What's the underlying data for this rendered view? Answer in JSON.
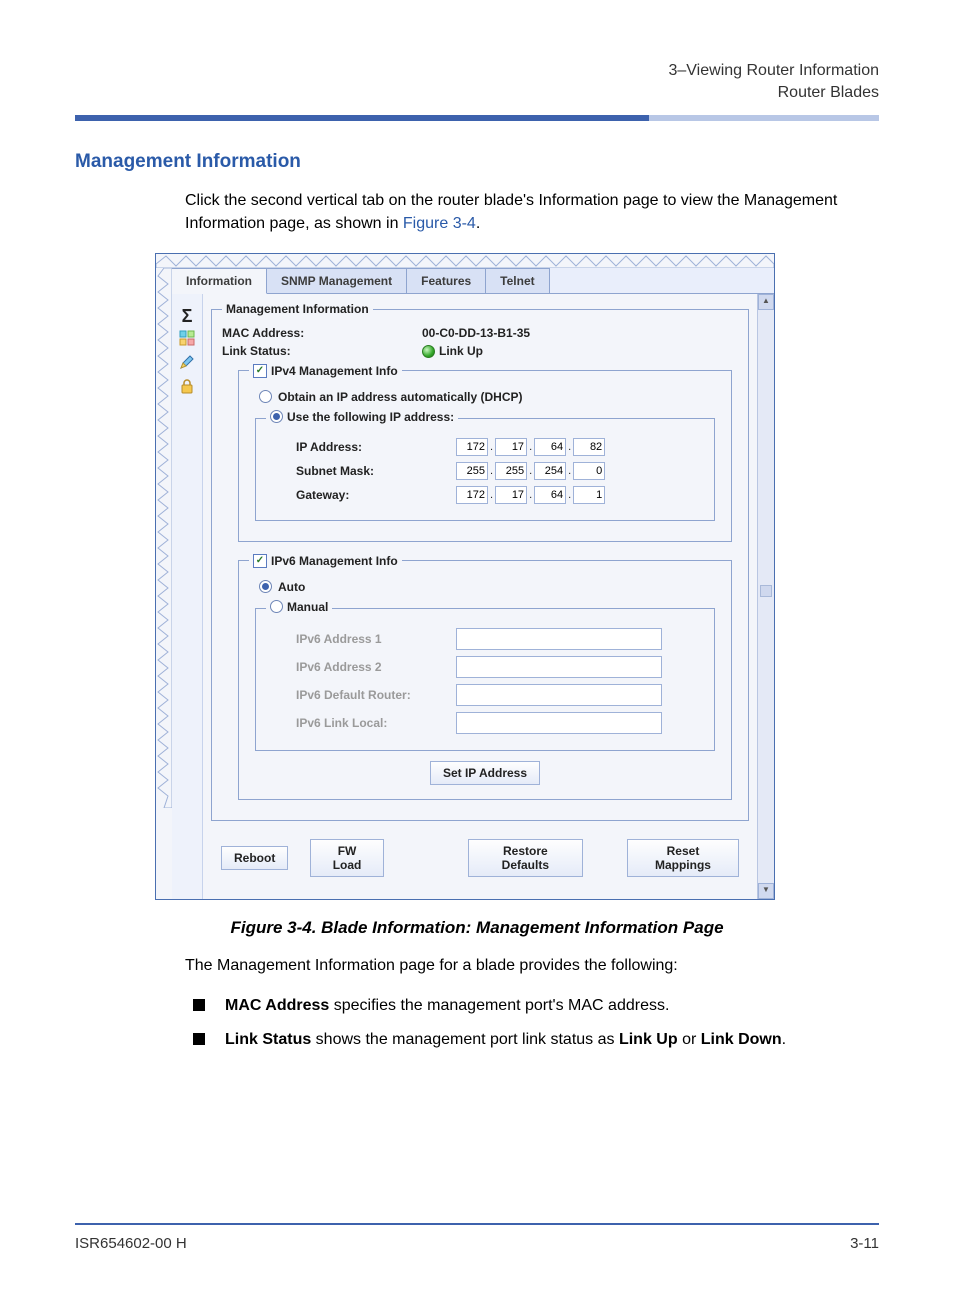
{
  "header": {
    "line1": "3–Viewing Router Information",
    "line2": "Router Blades"
  },
  "section_title": "Management Information",
  "intro_text_1": "Click the second vertical tab on the router blade's Information page to view the Management Information page, as shown in ",
  "intro_link": "Figure 3-4",
  "intro_text_2": ".",
  "tabs": {
    "information": "Information",
    "snmp": "SNMP Management",
    "features": "Features",
    "telnet": "Telnet"
  },
  "panel": {
    "legend": "Management Information",
    "mac_label": "MAC Address:",
    "mac_value": "00-C0-DD-13-B1-35",
    "link_label": "Link Status:",
    "link_value": "Link Up",
    "ipv4": {
      "legend": "IPv4 Management Info",
      "dhcp": "Obtain an IP address automatically (DHCP)",
      "use_following": "Use the following IP address:",
      "ip_label": "IP Address:",
      "ip": [
        "172",
        "17",
        "64",
        "82"
      ],
      "mask_label": "Subnet Mask:",
      "mask": [
        "255",
        "255",
        "254",
        "0"
      ],
      "gw_label": "Gateway:",
      "gw": [
        "172",
        "17",
        "64",
        "1"
      ]
    },
    "ipv6": {
      "legend": "IPv6 Management Info",
      "auto": "Auto",
      "manual": "Manual",
      "addr1": "IPv6 Address 1",
      "addr2": "IPv6 Address 2",
      "router": "IPv6 Default Router:",
      "linklocal": "IPv6 Link Local:"
    },
    "set_ip_btn": "Set IP Address",
    "buttons": {
      "reboot": "Reboot",
      "fwload": "FW Load",
      "restore": "Restore Defaults",
      "reset": "Reset Mappings"
    }
  },
  "figcaption": "Figure 3-4. Blade Information: Management Information Page",
  "after_text": "The Management Information page for a blade provides the following:",
  "bullets": {
    "b1_bold": "MAC Address",
    "b1_rest": " specifies the management port's MAC address.",
    "b2_bold1": "Link Status",
    "b2_mid": " shows the management port link status as ",
    "b2_bold2": "Link Up",
    "b2_or": " or ",
    "b2_bold3": "Link Down",
    "b2_end": "."
  },
  "footer": {
    "left": "ISR654602-00  H",
    "right": "3-11"
  }
}
